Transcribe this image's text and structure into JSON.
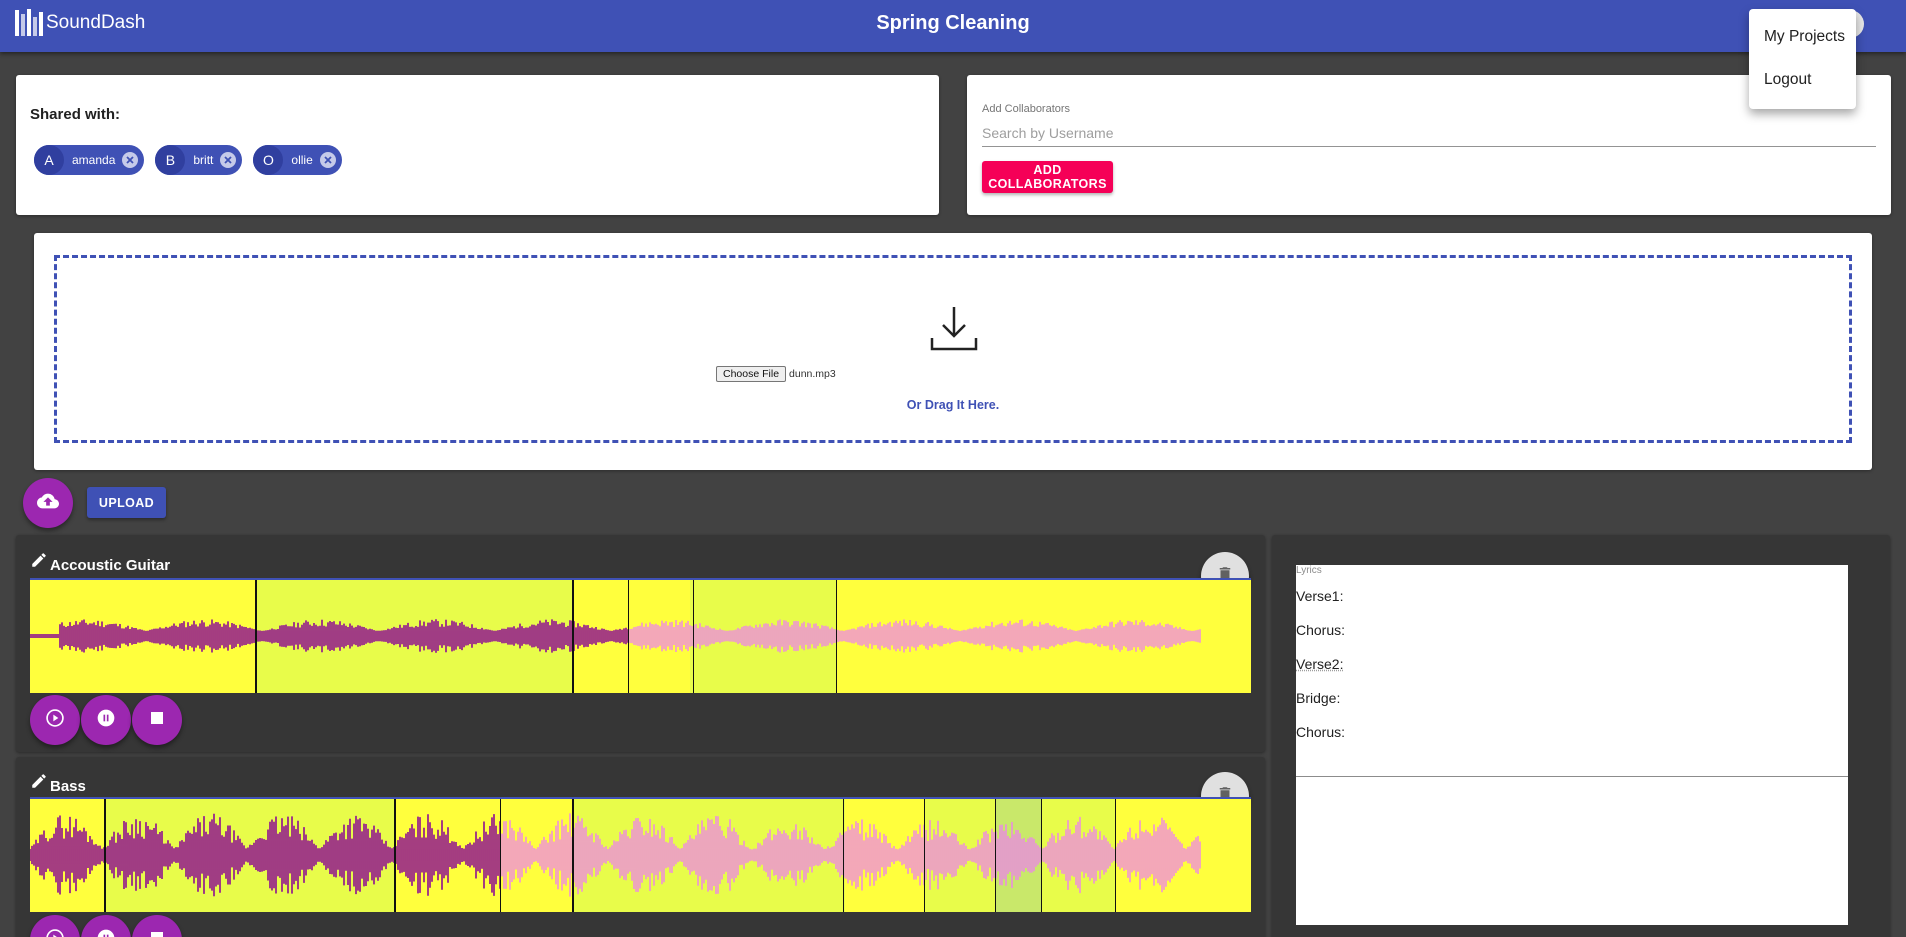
{
  "app": {
    "brand": "SoundDash",
    "title": "Spring Cleaning"
  },
  "menu": {
    "items": [
      "My Projects",
      "Logout"
    ]
  },
  "shared": {
    "label": "Shared with:",
    "users": [
      {
        "initial": "A",
        "name": "amanda"
      },
      {
        "initial": "B",
        "name": "britt"
      },
      {
        "initial": "O",
        "name": "ollie"
      }
    ]
  },
  "collaborators": {
    "field_label": "Add Collaborators",
    "placeholder": "Search by Username",
    "button": "ADD COLLABORATORS"
  },
  "dropzone": {
    "choose_label": "Choose File",
    "file_name": "dunn.mp3",
    "drag_text": "Or Drag It Here."
  },
  "upload": {
    "button": "UPLOAD"
  },
  "tracks": [
    {
      "name": "Accoustic Guitar"
    },
    {
      "name": "Bass"
    }
  ],
  "lyrics": {
    "label": "Lyrics",
    "lines": [
      "Verse1:",
      "Chorus:",
      "Verse2:",
      "Bridge:",
      "Chorus:"
    ]
  },
  "colors": {
    "primary": "#3f51b5",
    "secondary": "#f50057",
    "fab": "#9c27b0",
    "waveform_bg": "#ffff3d",
    "wave_played": "#800080",
    "wave_unplayed": "#ee82ee"
  }
}
